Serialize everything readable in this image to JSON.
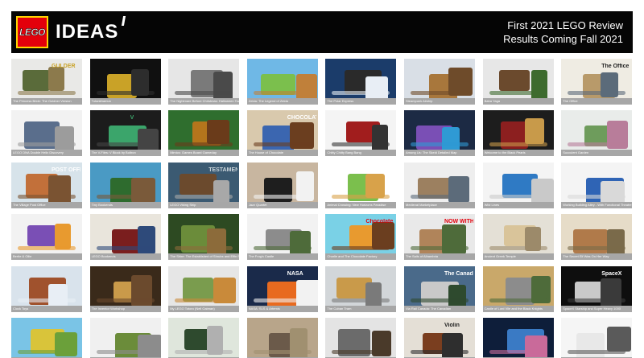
{
  "brand": {
    "logo_text": "LEGO",
    "product": "IDEAS"
  },
  "headline": {
    "line1": "First 2021 LEGO Review",
    "line2": "Results Coming Fall 2021"
  },
  "colors": {
    "header_bg": "#050505",
    "lego_red": "#e3000b",
    "lego_yellow": "#ffd500",
    "caption_bar": "#a7a7a7"
  },
  "projects": [
    {
      "title": "The Princess Bride: The Goldner Version",
      "bg": "#e9e9e7",
      "c1": "#5a6b3a",
      "c2": "#8c7a4c",
      "label": "GULDER",
      "label_color": "#c9a227"
    },
    {
      "title": "Tutankhamun",
      "bg": "#101010",
      "c1": "#c9a227",
      "c2": "#2d2d2d",
      "label": "",
      "label_color": "#fff"
    },
    {
      "title": "The Nightmare Before Christmas: Halloween Town",
      "bg": "#e6e6e6",
      "c1": "#7a7a7a",
      "c2": "#4a4a4a",
      "label": "",
      "label_color": "#fff"
    },
    {
      "title": "Zelda: The Legend of Zelda",
      "bg": "#6fb8e6",
      "c1": "#7bbf4d",
      "c2": "#c0803a",
      "label": "",
      "label_color": "#fff"
    },
    {
      "title": "The Polar Express",
      "bg": "#1b3c6a",
      "c1": "#2a2a2a",
      "c2": "#e8eef5",
      "label": "",
      "label_color": "#fff"
    },
    {
      "title": "Steampunk Airship",
      "bg": "#d9dfe6",
      "c1": "#a8773c",
      "c2": "#6e4b2a",
      "label": "",
      "label_color": "#fff"
    },
    {
      "title": "Baba Yaga",
      "bg": "#e7e7e7",
      "c1": "#6b4a2d",
      "c2": "#3d6b2e",
      "label": "",
      "label_color": "#fff"
    },
    {
      "title": "The Office",
      "bg": "#efece3",
      "c1": "#b89a6a",
      "c2": "#5b6b7a",
      "label": "The Office",
      "label_color": "#222"
    },
    {
      "title": "LEGO DNA Double Helix Discovery",
      "bg": "#f2f2f2",
      "c1": "#5a6e8c",
      "c2": "#9c9c9c",
      "label": "",
      "label_color": "#fff"
    },
    {
      "title": "The V-Files: V Block by Boltron",
      "bg": "#1c1c1c",
      "c1": "#3ba56b",
      "c2": "#444",
      "label": "V",
      "label_color": "#3ba56b"
    },
    {
      "title": "Mimics: Games Board Gameday",
      "bg": "#2f6e2e",
      "c1": "#b4751c",
      "c2": "#6a3b1a",
      "label": "",
      "label_color": "#fff"
    },
    {
      "title": "The House of Chocolate",
      "bg": "#d9c9ad",
      "c1": "#3b66b0",
      "c2": "#6b3e1f",
      "label": "CHOCOLATE",
      "label_color": "#fff"
    },
    {
      "title": "Chitty Chitty Bang Bang",
      "bg": "#f4f4f4",
      "c1": "#a11d1d",
      "c2": "#333",
      "label": "",
      "label_color": "#fff"
    },
    {
      "title": "Among Us: The Skeld Detailed Map",
      "bg": "#1c2a44",
      "c1": "#7a4fb5",
      "c2": "#2f9ad4",
      "label": "",
      "label_color": "#fff"
    },
    {
      "title": "Welcome to the Black Pearls",
      "bg": "#1d1d1d",
      "c1": "#8c1f1f",
      "c2": "#c89a4a",
      "label": "",
      "label_color": "#fff"
    },
    {
      "title": "Succulent Garden",
      "bg": "#e9ecea",
      "c1": "#6e9c5c",
      "c2": "#b87d9a",
      "label": "",
      "label_color": "#fff"
    },
    {
      "title": "The Village Post Office",
      "bg": "#d7e3ea",
      "c1": "#c2703a",
      "c2": "#7a5332",
      "label": "POST OFFICE",
      "label_color": "#fff"
    },
    {
      "title": "Tiny Bookends",
      "bg": "#4a9ac4",
      "c1": "#2e6b2e",
      "c2": "#7a5a3a",
      "label": "",
      "label_color": "#fff"
    },
    {
      "title": "LEGO Viking Ship",
      "bg": "#3b5a72",
      "c1": "#6b4a2d",
      "c2": "#a8a8a8",
      "label": "TESTAMENT",
      "label_color": "#cfd8dd"
    },
    {
      "title": "Jazz Quartet",
      "bg": "#c8b6a0",
      "c1": "#1e1e1e",
      "c2": "#f2f2f2",
      "label": "",
      "label_color": "#fff"
    },
    {
      "title": "Animal Crossing: New Horizons Paradise",
      "bg": "#ffffff",
      "c1": "#7bbf4d",
      "c2": "#d8a24a",
      "label": "",
      "label_color": "#fff"
    },
    {
      "title": "Medieval Marketplace",
      "bg": "#eeeeee",
      "c1": "#9c8060",
      "c2": "#5c6b7a",
      "label": "",
      "label_color": "#fff"
    },
    {
      "title": "Wild Lines",
      "bg": "#f4f4f4",
      "c1": "#2f7ac4",
      "c2": "#c9c9c9",
      "label": "",
      "label_color": "#fff"
    },
    {
      "title": "Working Building Alley - With Functional Theatre & Backstreet",
      "bg": "#f4f4f4",
      "c1": "#2f64b5",
      "c2": "#d9d9d9",
      "label": "",
      "label_color": "#fff"
    },
    {
      "title": "Bertie & Ollie",
      "bg": "#f2f2f2",
      "c1": "#7a4fb5",
      "c2": "#e89a2f",
      "label": "",
      "label_color": "#fff"
    },
    {
      "title": "LEGO Bookends",
      "bg": "#e9e5dc",
      "c1": "#7a1e1e",
      "c2": "#2e4a7a",
      "label": "",
      "label_color": "#fff"
    },
    {
      "title": "The Shire: The Established of Shrubs and Elfin Romans",
      "bg": "#2d4a22",
      "c1": "#6b8c3a",
      "c2": "#8c6b3a",
      "label": "",
      "label_color": "#fff"
    },
    {
      "title": "The Frog's Castle",
      "bg": "#f2f2f2",
      "c1": "#8c8c8c",
      "c2": "#4e6b3a",
      "label": "",
      "label_color": "#fff"
    },
    {
      "title": "Charlie and The Chocolate Factory",
      "bg": "#7ad1e6",
      "c1": "#e89a2f",
      "c2": "#6b3e1f",
      "label": "Chocolate",
      "label_color": "#e3000b"
    },
    {
      "title": "The Sails of Alhambria",
      "bg": "#e9e9e9",
      "c1": "#b0845a",
      "c2": "#4e6b3a",
      "label": "NOW WITH",
      "label_color": "#e3000b"
    },
    {
      "title": "Ancient Greek Temple",
      "bg": "#e4e0d6",
      "c1": "#d9c49a",
      "c2": "#9c8a6a",
      "label": "",
      "label_color": "#fff"
    },
    {
      "title": "The Secret Elf Was On Her Way",
      "bg": "#e6dcc8",
      "c1": "#b07a4a",
      "c2": "#7a6a4a",
      "label": "",
      "label_color": "#fff"
    },
    {
      "title": "Clock Toys",
      "bg": "#d9e3ec",
      "c1": "#a0522d",
      "c2": "#e8eef5",
      "label": "",
      "label_color": "#fff"
    },
    {
      "title": "The Inventor Workshop",
      "bg": "#3a2a1a",
      "c1": "#c99a4a",
      "c2": "#6b4a2d",
      "label": "",
      "label_color": "#fff"
    },
    {
      "title": "My LEGO Totoro (Neil Gaiman)",
      "bg": "#e6e6e6",
      "c1": "#7a9c4e",
      "c2": "#c98a3a",
      "label": "",
      "label_color": "#fff"
    },
    {
      "title": "NASA: SLS & Artemis",
      "bg": "#1a2a4a",
      "c1": "#e86a1f",
      "c2": "#f2f2f2",
      "label": "NASA",
      "label_color": "#fff"
    },
    {
      "title": "The Cuban Tram",
      "bg": "#d2d6d9",
      "c1": "#c99a4a",
      "c2": "#7a7a7a",
      "label": "",
      "label_color": "#fff"
    },
    {
      "title": "Via Rail Canada: The Canadian",
      "bg": "#4a6a8a",
      "c1": "#c9c9c9",
      "c2": "#2e4a2e",
      "label": "The Canadian",
      "label_color": "#fff"
    },
    {
      "title": "Castle of Lord Vile and the Black Knights",
      "bg": "#c9a86a",
      "c1": "#8c8c8c",
      "c2": "#4e6b3a",
      "label": "",
      "label_color": "#fff"
    },
    {
      "title": "SpaceX Starship and Super Heavy 1000",
      "bg": "#0e0e0e",
      "c1": "#c9c9c9",
      "c2": "#3a3a3a",
      "label": "SpaceX",
      "label_color": "#fff"
    },
    {
      "title": "The Simpsons House",
      "bg": "#7ac4e6",
      "c1": "#d9c43a",
      "c2": "#6ba03a",
      "label": "",
      "label_color": "#fff"
    },
    {
      "title": "Castle Ruins",
      "bg": "#f0f0f0",
      "c1": "#6b8c3a",
      "c2": "#8c8c8c",
      "label": "",
      "label_color": "#fff"
    },
    {
      "title": "Vintage Racing Car",
      "bg": "#dfe6dc",
      "c1": "#2e4a2e",
      "c2": "#b0b0b0",
      "label": "",
      "label_color": "#fff"
    },
    {
      "title": "Toy Shop",
      "bg": "#b8a58a",
      "c1": "#6b5a4a",
      "c2": "#a09070",
      "label": "",
      "label_color": "#fff"
    },
    {
      "title": "Haunted Chapel",
      "bg": "#e4e4e4",
      "c1": "#6b6b6b",
      "c2": "#4a3a2a",
      "label": "",
      "label_color": "#fff"
    },
    {
      "title": "Violin",
      "bg": "#e4dfd6",
      "c1": "#7a3e1f",
      "c2": "#2e2e2e",
      "label": "Violin",
      "label_color": "#222"
    },
    {
      "title": "Aquarium Jars",
      "bg": "#0e1e3a",
      "c1": "#3a7ac4",
      "c2": "#c96a9a",
      "label": "",
      "label_color": "#fff"
    },
    {
      "title": "Astronaut",
      "bg": "#f5f5f5",
      "c1": "#e8e8e8",
      "c2": "#5a5a5a",
      "label": "",
      "label_color": "#fff"
    }
  ]
}
